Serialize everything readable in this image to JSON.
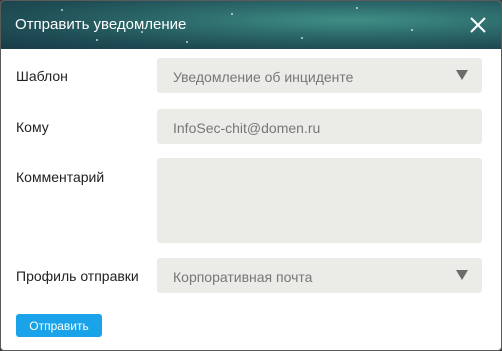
{
  "dialog": {
    "title": "Отправить уведомление",
    "close_icon": "close-icon"
  },
  "form": {
    "template": {
      "label": "Шаблон",
      "value": "Уведомление об инциденте"
    },
    "recipient": {
      "label": "Кому",
      "value": "InfoSec-chit@domen.ru"
    },
    "comment": {
      "label": "Комментарий",
      "value": ""
    },
    "send_profile": {
      "label": "Профиль отправки",
      "value": "Корпоративная почта"
    }
  },
  "actions": {
    "send_label": "Отправить"
  },
  "colors": {
    "accent": "#1aa3e8",
    "field_bg": "#ebebe8",
    "title_text": "#ffffff"
  }
}
